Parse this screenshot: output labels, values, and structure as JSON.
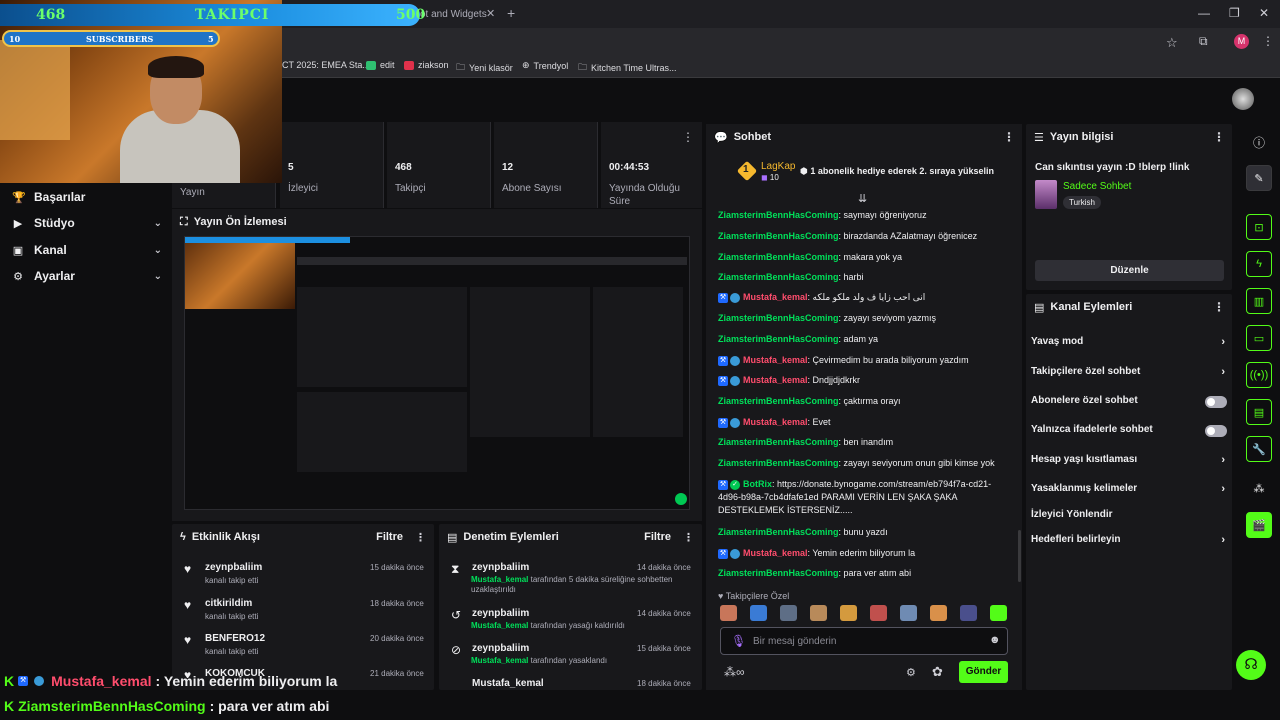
{
  "browser": {
    "tab_title": "ot and Widgets",
    "new_tab": "+",
    "bookmarks": [
      "CT 2025: EMEA Sta...",
      "edit",
      "ziakson",
      "Yeni klasör",
      "Trendyol",
      "Kitchen Time Ultras..."
    ],
    "profile_initial": "M"
  },
  "overlay": {
    "follow_start": "468",
    "follow_label": "TAKIPCI",
    "follow_goal": "500",
    "follow_progress": 0.936,
    "sub_start": "10",
    "sub_label": "SUBSCRIBERS",
    "sub_goal": "5",
    "bottom_messages": [
      {
        "name": "Mustafa_kemal",
        "text": ": Yemin ederim biliyorum la"
      },
      {
        "name": "ZiamsterimBennHasComing",
        "text": ": para ver atım abi"
      }
    ]
  },
  "nav": {
    "items": [
      {
        "label": "Başarılar",
        "icon": "trophy-icon"
      },
      {
        "label": "Stüdyo",
        "icon": "video-icon"
      },
      {
        "label": "Kanal",
        "icon": "channel-icon"
      },
      {
        "label": "Ayarlar",
        "icon": "gear-icon"
      }
    ],
    "stream_label": "Yayın"
  },
  "stats": [
    {
      "value": "5",
      "label": "İzleyici"
    },
    {
      "value": "468",
      "label": "Takipçi"
    },
    {
      "value": "12",
      "label": "Abone Sayısı"
    },
    {
      "value": "00:44:53",
      "label": "Yayında Olduğu Süre"
    }
  ],
  "preview": {
    "title": "Yayın Ön İzlemesi"
  },
  "activity": {
    "title": "Etkinlik Akışı",
    "filter": "Filtre",
    "items": [
      {
        "name": "zeynpbaliim",
        "sub": "kanalı takip etti",
        "time": "15 dakika önce"
      },
      {
        "name": "citkirildim",
        "sub": "kanalı takip etti",
        "time": "18 dakika önce"
      },
      {
        "name": "BENFERO12",
        "sub": "kanalı takip etti",
        "time": "20 dakika önce"
      },
      {
        "name": "KOKOMCUK",
        "sub": "",
        "time": "21 dakika önce"
      }
    ]
  },
  "moderation": {
    "title": "Denetim Eylemleri",
    "filter": "Filtre",
    "items": [
      {
        "name": "zeynpbaliim",
        "actor": "Mustafa_kemal",
        "text": "tarafından 5 dakika süreliğine sohbetten uzaklaştırıldı",
        "time": "14 dakika önce"
      },
      {
        "name": "zeynpbaliim",
        "actor": "Mustafa_kemal",
        "text": "tarafından yasağı kaldırıldı",
        "time": "14 dakika önce"
      },
      {
        "name": "zeynpbaliim",
        "actor": "Mustafa_kemal",
        "text": "tarafından yasaklandı",
        "time": "15 dakika önce"
      },
      {
        "name": "Mustafa_kemal",
        "actor": "",
        "text": "",
        "time": "18 dakika önce"
      }
    ]
  },
  "chat": {
    "title": "Sohbet",
    "pinned_user": "LagKap",
    "pinned_level": "10",
    "pinned_text": "1 abonelik hediye ederek 2. sıraya yükselin",
    "messages": [
      {
        "user": "ZiamsterimBennHasComing",
        "text": ": saymayı öğreniyoruz",
        "color": "green"
      },
      {
        "user": "ZiamsterimBennHasComing",
        "text": ": birazdanda AZalatmayı öğrenicez",
        "color": "green"
      },
      {
        "user": "ZiamsterimBennHasComing",
        "text": ": makara yok ya",
        "color": "green"
      },
      {
        "user": "ZiamsterimBennHasComing",
        "text": ": harbi",
        "color": "green"
      },
      {
        "user": "Mustafa_kemal",
        "text": ": انی احب زایا ف ولد ملکو ملکه",
        "color": "red"
      },
      {
        "user": "ZiamsterimBennHasComing",
        "text": ": zayayı seviyom yazmış",
        "color": "green"
      },
      {
        "user": "ZiamsterimBennHasComing",
        "text": ": adam ya",
        "color": "green"
      },
      {
        "user": "Mustafa_kemal",
        "text": ": Çevirmedim bu arada biliyorum yazdım",
        "color": "red"
      },
      {
        "user": "Mustafa_kemal",
        "text": ": Dndjjdjdkrkr",
        "color": "red"
      },
      {
        "user": "ZiamsterimBennHasComing",
        "text": ": çaktırma orayı",
        "color": "green"
      },
      {
        "user": "Mustafa_kemal",
        "text": ": Evet",
        "color": "red"
      },
      {
        "user": "ZiamsterimBennHasComing",
        "text": ": ben inandım",
        "color": "green"
      },
      {
        "user": "ZiamsterimBennHasComing",
        "text": ": zayayı seviyorum onun gibi kimse yok",
        "color": "green"
      },
      {
        "user": "BotRix",
        "text": ": https://donate.bynogame.com/stream/eb794f7a-cd21-4d96-b98a-7cb4dfafe1ed PARAMI VERİN LEN ŞAKA ŞAKA DESTEKLEMEK İSTERSENİZ.....",
        "color": "green"
      },
      {
        "user": "ZiamsterimBennHasComing",
        "text": ": bunu yazdı",
        "color": "green"
      },
      {
        "user": "Mustafa_kemal",
        "text": ": Yemin ederim biliyorum la",
        "color": "red"
      },
      {
        "user": "ZiamsterimBennHasComing",
        "text": ": para ver atım abi",
        "color": "green"
      }
    ],
    "followers_only": "Takipçilere Özel",
    "input_placeholder": "Bir mesaj gönderin",
    "send_label": "Gönder"
  },
  "stream_info": {
    "title": "Yayın bilgisi",
    "stream_title": "Can sıkıntısı yayın :D !blerp !link",
    "category": "Sadece Sohbet",
    "tag": "Turkish",
    "edit_label": "Düzenle"
  },
  "channel_actions": {
    "title": "Kanal Eylemleri",
    "items": [
      {
        "label": "Yavaş mod",
        "control": "chevron"
      },
      {
        "label": "Takipçilere özel sohbet",
        "control": "chevron"
      },
      {
        "label": "Abonelere özel sohbet",
        "control": "toggle"
      },
      {
        "label": "Yalnızca ifadelerle sohbet",
        "control": "toggle"
      },
      {
        "label": "Hesap yaşı kısıtlaması",
        "control": "chevron"
      },
      {
        "label": "Yasaklanmış kelimeler",
        "control": "chevron"
      },
      {
        "label": "İzleyici Yönlendir",
        "control": "none"
      },
      {
        "label": "Hedefleri belirleyin",
        "control": "chevron"
      }
    ]
  },
  "colors": {
    "accent": "#53fc18",
    "chat_green": "#00e05a",
    "chat_red": "#ff4d6d",
    "panel": "#18181b"
  }
}
